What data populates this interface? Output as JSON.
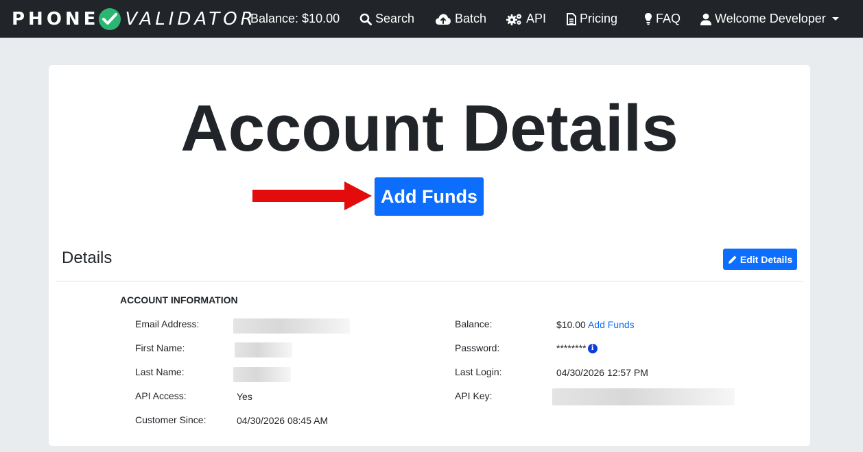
{
  "brand": {
    "part1": "PHONE",
    "part2": "VALIDATOR"
  },
  "nav": {
    "balance": "Balance: $10.00",
    "search": "Search",
    "batch": "Batch",
    "api": "API",
    "pricing": "Pricing",
    "faq": "FAQ",
    "user": "Welcome Developer"
  },
  "page": {
    "title": "Account Details",
    "add_funds_button": "Add Funds"
  },
  "details": {
    "title": "Details",
    "edit_button": "Edit Details",
    "section_heading": "ACCOUNT INFORMATION",
    "left": {
      "email_label": "Email Address:",
      "first_name_label": "First Name:",
      "last_name_label": "Last Name:",
      "api_access_label": "API Access:",
      "api_access_value": "Yes",
      "customer_since_label": "Customer Since:",
      "customer_since_value": "04/30/2026 08:45 AM"
    },
    "right": {
      "balance_label": "Balance:",
      "balance_value": "$10.00",
      "balance_link": "Add Funds",
      "password_label": "Password:",
      "password_value": "********",
      "last_login_label": "Last Login:",
      "last_login_value": "04/30/2026 12:57 PM",
      "api_key_label": "API Key:"
    }
  },
  "colors": {
    "navbar": "#212529",
    "primary": "#0d6efd",
    "check": "#2bb673",
    "arrow": "#e30b0b",
    "background": "#e9ecef"
  }
}
